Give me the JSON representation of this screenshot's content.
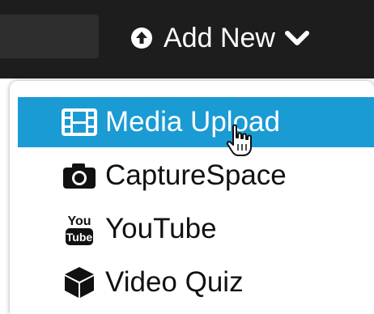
{
  "header": {
    "add_new_label": "Add New",
    "add_new_icon": "circle-arrow-up-icon",
    "chevron_icon": "chevron-down-icon"
  },
  "menu": {
    "items": [
      {
        "label": "Media Upload",
        "icon": "film-icon",
        "active": true
      },
      {
        "label": "CaptureSpace",
        "icon": "camera-icon",
        "active": false
      },
      {
        "label": "YouTube",
        "icon": "youtube-icon",
        "active": false
      },
      {
        "label": "Video Quiz",
        "icon": "cube-icon",
        "active": false
      }
    ]
  },
  "colors": {
    "topbar": "#1d1d1d",
    "highlight": "#1a9bd4",
    "text": "#111111"
  }
}
